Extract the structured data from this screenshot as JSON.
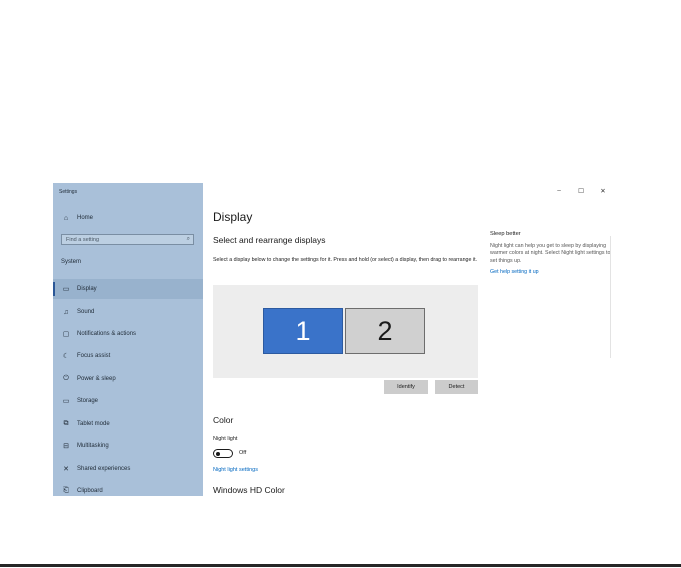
{
  "window": {
    "app_title": "Settings",
    "minimize": "–",
    "maximize": "☐",
    "close": "✕"
  },
  "sidebar": {
    "home": {
      "icon": "home-icon",
      "glyph": "⌂",
      "label": "Home"
    },
    "search": {
      "placeholder": "Find a setting",
      "icon": "search-icon",
      "glyph": "⌕"
    },
    "section": "System",
    "items": [
      {
        "id": "display",
        "icon": "monitor-icon",
        "glyph": "▭",
        "label": "Display",
        "active": true
      },
      {
        "id": "sound",
        "icon": "speaker-icon",
        "glyph": "♫",
        "label": "Sound"
      },
      {
        "id": "notifications",
        "icon": "notification-icon",
        "glyph": "▢",
        "label": "Notifications & actions"
      },
      {
        "id": "focus",
        "icon": "moon-icon",
        "glyph": "☾",
        "label": "Focus assist"
      },
      {
        "id": "power",
        "icon": "power-icon",
        "glyph": "⏻",
        "label": "Power & sleep"
      },
      {
        "id": "storage",
        "icon": "storage-icon",
        "glyph": "▭",
        "label": "Storage"
      },
      {
        "id": "tablet",
        "icon": "tablet-icon",
        "glyph": "⧉",
        "label": "Tablet mode"
      },
      {
        "id": "multitasking",
        "icon": "multitasking-icon",
        "glyph": "⊟",
        "label": "Multitasking"
      },
      {
        "id": "shared",
        "icon": "shared-experiences-icon",
        "glyph": "✕",
        "label": "Shared experiences"
      },
      {
        "id": "clipboard",
        "icon": "clipboard-icon",
        "glyph": "⎗",
        "label": "Clipboard"
      }
    ]
  },
  "main": {
    "title": "Display",
    "arrange_heading": "Select and rearrange displays",
    "arrange_desc": "Select a display below to change the settings for it. Press and hold (or select) a display, then drag to rearrange it.",
    "monitors": [
      {
        "label": "1",
        "selected": true
      },
      {
        "label": "2",
        "selected": false
      }
    ],
    "identify_label": "Identify",
    "detect_label": "Detect",
    "color_heading": "Color",
    "night_light_label": "Night light",
    "night_light_state": "Off",
    "night_light_link": "Night light settings",
    "hd_color_heading": "Windows HD Color"
  },
  "side_panel": {
    "title": "Sleep better",
    "text": "Night light can help you get to sleep by displaying warmer colors at night. Select Night light settings to set things up.",
    "link": "Get help setting it up"
  },
  "colors": {
    "sidebar_bg": "#a9c0d9",
    "accent": "#2b5797",
    "monitor_selected": "#3a73c9",
    "link": "#0067c0"
  }
}
